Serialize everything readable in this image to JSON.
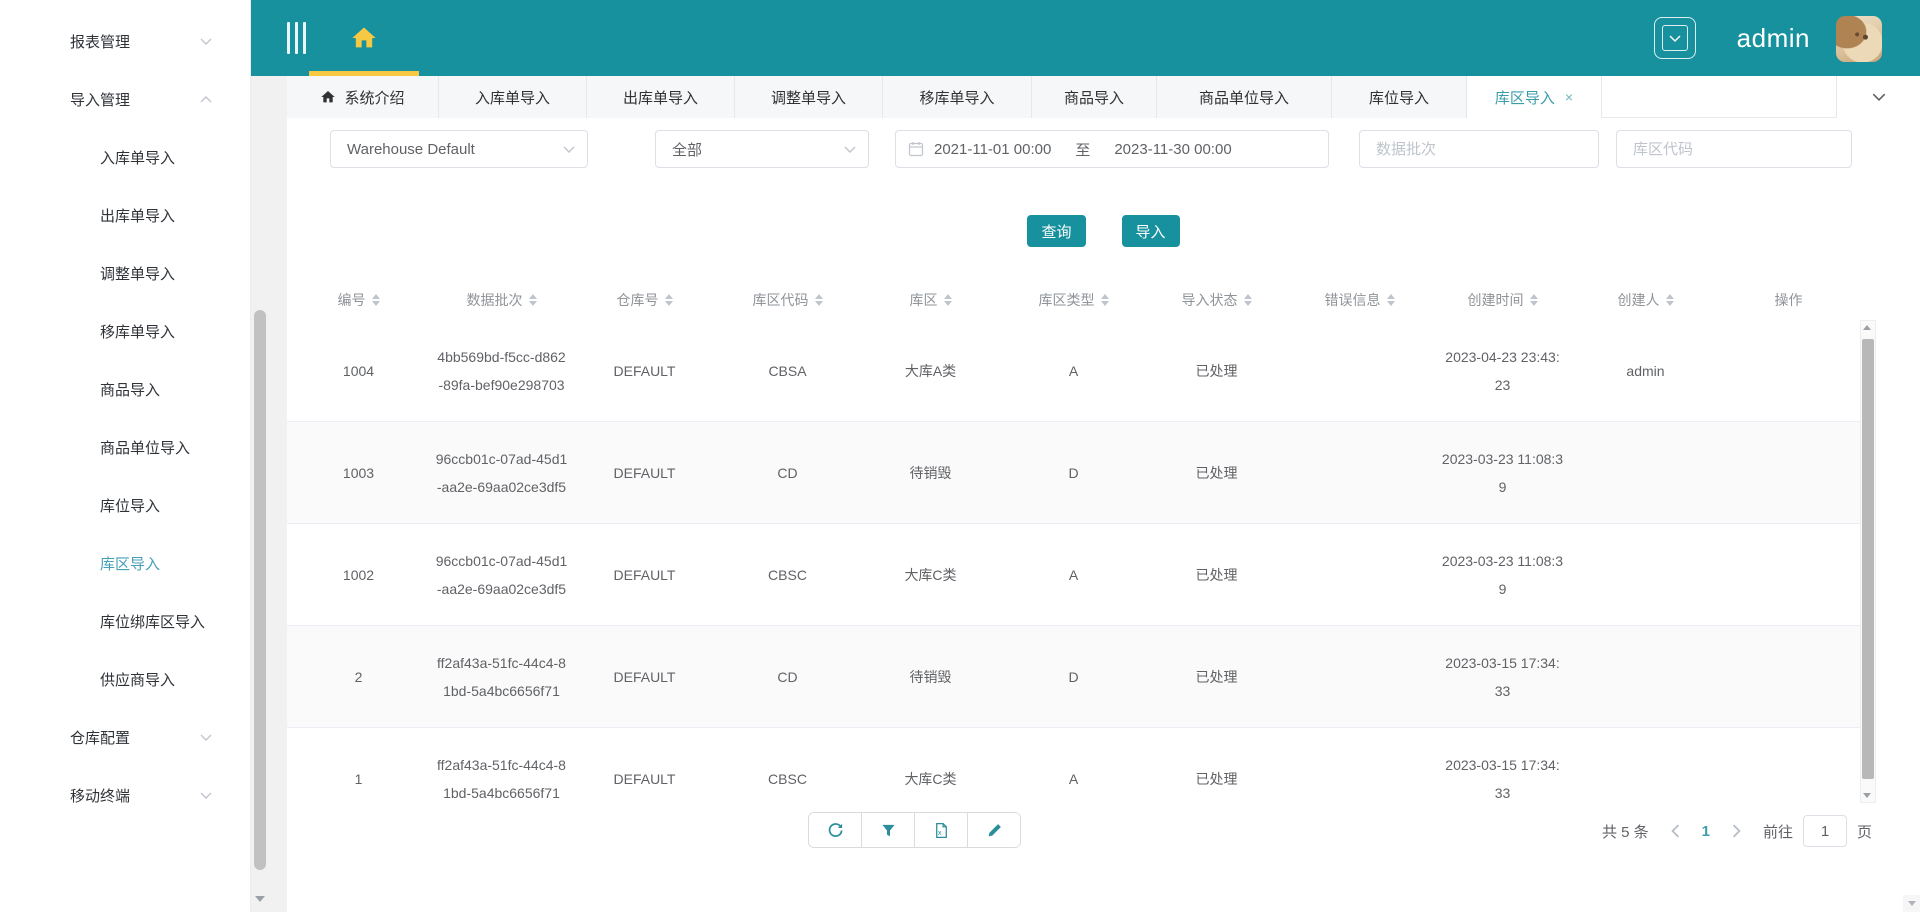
{
  "colors": {
    "header_teal": "#17919e",
    "accent_yellow": "#f7c843",
    "active_text_teal": "#3b9cab",
    "sidebar_active_teal": "#45a0b5",
    "button_teal": "#17919e",
    "text_primary": "#303133",
    "text_secondary": "#606266",
    "table_header_gray": "#8f9499",
    "stripe_row": "#fafafa"
  },
  "icons": {
    "hamburger-icon": "three-vertical-bars",
    "home-icon": "house-glyph",
    "chevron-down-icon": "v-chevron",
    "chevron-up-icon": "inverted-v-chevron",
    "close-icon": "×",
    "calendar-icon": "calendar-grid",
    "refresh-icon": "circular-arrow",
    "filter-icon": "funnel",
    "excel-export-icon": "spreadsheet-file-x",
    "edit-icon": "pencil",
    "sort-carets-icon": "up-down-triangles",
    "scroll-down-icon": "down-triangle",
    "scroll-up-icon": "up-triangle"
  },
  "header": {
    "username": "admin"
  },
  "sidebar": {
    "groups": [
      {
        "label": "报表管理",
        "state": "collapsed"
      },
      {
        "label": "导入管理",
        "state": "expanded",
        "children": [
          {
            "label": "入库单导入"
          },
          {
            "label": "出库单导入"
          },
          {
            "label": "调整单导入"
          },
          {
            "label": "移库单导入"
          },
          {
            "label": "商品导入"
          },
          {
            "label": "商品单位导入"
          },
          {
            "label": "库位导入"
          },
          {
            "label": "库区导入",
            "active": true
          },
          {
            "label": "库位绑库区导入"
          },
          {
            "label": "供应商导入"
          }
        ]
      },
      {
        "label": "仓库配置",
        "state": "collapsed"
      },
      {
        "label": "移动终端",
        "state": "collapsed"
      }
    ]
  },
  "tabs": [
    {
      "label": "系统介绍",
      "icon": "home"
    },
    {
      "label": "入库单导入"
    },
    {
      "label": "出库单导入"
    },
    {
      "label": "调整单导入"
    },
    {
      "label": "移库单导入"
    },
    {
      "label": "商品导入"
    },
    {
      "label": "商品单位导入"
    },
    {
      "label": "库位导入"
    },
    {
      "label": "库区导入",
      "active": true,
      "closable": true,
      "close_glyph": "×"
    }
  ],
  "filters": {
    "warehouse_value": "Warehouse Default",
    "status_value": "全部",
    "date_from": "2021-11-01 00:00",
    "date_separator": "至",
    "date_to": "2023-11-30 00:00",
    "batch_placeholder": "数据批次",
    "code_placeholder": "库区代码"
  },
  "actions": {
    "search_label": "查询",
    "import_label": "导入"
  },
  "table": {
    "columns": [
      {
        "label": "编号",
        "sortable": true
      },
      {
        "label": "数据批次",
        "sortable": true
      },
      {
        "label": "仓库号",
        "sortable": true
      },
      {
        "label": "库区代码",
        "sortable": true
      },
      {
        "label": "库区",
        "sortable": true
      },
      {
        "label": "库区类型",
        "sortable": true
      },
      {
        "label": "导入状态",
        "sortable": true
      },
      {
        "label": "错误信息",
        "sortable": true
      },
      {
        "label": "创建时间",
        "sortable": true
      },
      {
        "label": "创建人",
        "sortable": true
      },
      {
        "label": "操作",
        "sortable": false
      }
    ],
    "rows": [
      {
        "id": "1004",
        "batch": "4bb569bd-f5cc-d862-89fa-bef90e298703",
        "warehouse": "DEFAULT",
        "code": "CBSA",
        "area": "大库A类",
        "type": "A",
        "status": "已处理",
        "error": "",
        "created": "2023-04-23 23:43:23",
        "creator": "admin"
      },
      {
        "id": "1003",
        "batch": "96ccb01c-07ad-45d1-aa2e-69aa02ce3df5",
        "warehouse": "DEFAULT",
        "code": "CD",
        "area": "待销毁",
        "type": "D",
        "status": "已处理",
        "error": "",
        "created": "2023-03-23 11:08:39",
        "creator": ""
      },
      {
        "id": "1002",
        "batch": "96ccb01c-07ad-45d1-aa2e-69aa02ce3df5",
        "warehouse": "DEFAULT",
        "code": "CBSC",
        "area": "大库C类",
        "type": "A",
        "status": "已处理",
        "error": "",
        "created": "2023-03-23 11:08:39",
        "creator": ""
      },
      {
        "id": "2",
        "batch": "ff2af43a-51fc-44c4-81bd-5a4bc6656f71",
        "warehouse": "DEFAULT",
        "code": "CD",
        "area": "待销毁",
        "type": "D",
        "status": "已处理",
        "error": "",
        "created": "2023-03-15 17:34:33",
        "creator": ""
      },
      {
        "id": "1",
        "batch": "ff2af43a-51fc-44c4-81bd-5a4bc6656f71",
        "warehouse": "DEFAULT",
        "code": "CBSC",
        "area": "大库C类",
        "type": "A",
        "status": "已处理",
        "error": "",
        "created": "2023-03-15 17:34:33",
        "creator": ""
      }
    ]
  },
  "pagination": {
    "total_label": "共 5 条",
    "current_page": "1",
    "goto_label": "前往",
    "goto_value": "1",
    "page_suffix": "页"
  }
}
